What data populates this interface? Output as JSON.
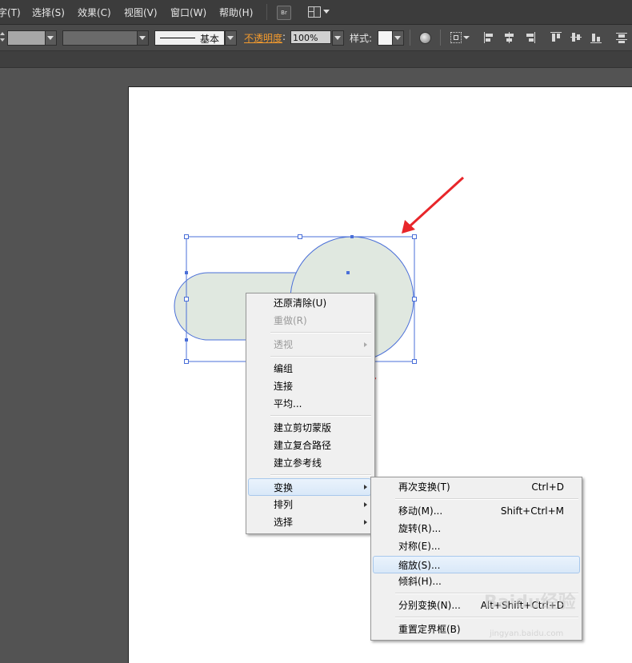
{
  "menubar": {
    "items": [
      "字(T)",
      "选择(S)",
      "效果(C)",
      "视图(V)",
      "窗口(W)",
      "帮助(H)"
    ],
    "bridge_label": "Br"
  },
  "control_bar": {
    "stroke_profile": "基本",
    "opacity_label": "不透明度",
    "opacity_value": "100%",
    "style_label": "样式:"
  },
  "context_menu": {
    "items": [
      {
        "label": "还原清除(U)",
        "enabled": true
      },
      {
        "label": "重做(R)",
        "enabled": false
      },
      {
        "label": "透视",
        "enabled": false,
        "submenu": true
      },
      {
        "label": "编组",
        "enabled": true
      },
      {
        "label": "连接",
        "enabled": true
      },
      {
        "label": "平均...",
        "enabled": true
      },
      {
        "label": "建立剪切蒙版",
        "enabled": true
      },
      {
        "label": "建立复合路径",
        "enabled": true
      },
      {
        "label": "建立参考线",
        "enabled": true
      },
      {
        "label": "变换",
        "enabled": true,
        "submenu": true,
        "highlighted": true
      },
      {
        "label": "排列",
        "enabled": true,
        "submenu": true
      },
      {
        "label": "选择",
        "enabled": true,
        "submenu": true
      }
    ]
  },
  "transform_submenu": {
    "items": [
      {
        "label": "再次变换(T)",
        "shortcut": "Ctrl+D"
      },
      {
        "label": "移动(M)...",
        "shortcut": "Shift+Ctrl+M"
      },
      {
        "label": "旋转(R)...",
        "shortcut": ""
      },
      {
        "label": "对称(E)...",
        "shortcut": ""
      },
      {
        "label": "缩放(S)...",
        "shortcut": "",
        "highlighted": true
      },
      {
        "label": "倾斜(H)...",
        "shortcut": ""
      },
      {
        "label": "分别变换(N)...",
        "shortcut": "Alt+Shift+Ctrl+D"
      },
      {
        "label": "重置定界框(B)",
        "shortcut": ""
      }
    ]
  },
  "watermark": {
    "text": "Baidu经验",
    "url": "jingyan.baidu.com"
  },
  "colors": {
    "shape_fill": "#e0e8e0",
    "selection": "#4a6fd8",
    "arrow": "#e8262a",
    "opacity_label": "#f29a2e"
  }
}
